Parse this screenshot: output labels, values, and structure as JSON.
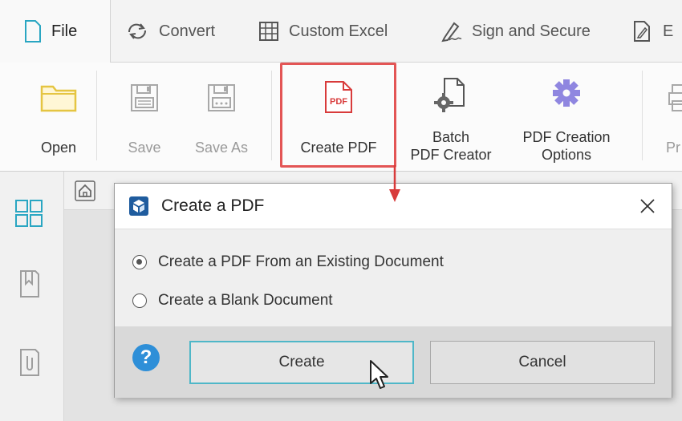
{
  "tabs": [
    {
      "label": "File",
      "icon": "file-icon",
      "active": true
    },
    {
      "label": "Convert",
      "icon": "convert-icon"
    },
    {
      "label": "Custom Excel",
      "icon": "table-icon"
    },
    {
      "label": "Sign and Secure",
      "icon": "signature-icon"
    },
    {
      "label": "E",
      "icon": "edit-icon"
    }
  ],
  "ribbon": {
    "open": "Open",
    "save": "Save",
    "save_as": "Save As",
    "create_pdf": "Create PDF",
    "create_pdf_icon_text": "PDF",
    "batch_line1": "Batch",
    "batch_line2": "PDF Creator",
    "options_line1": "PDF Creation",
    "options_line2": "Options",
    "partial": "Pr"
  },
  "dialog": {
    "title": "Create a PDF",
    "options": [
      {
        "label": "Create a PDF From an Existing Document",
        "checked": true
      },
      {
        "label": "Create a Blank Document",
        "checked": false
      }
    ],
    "help": "?",
    "create_label": "Create",
    "cancel_label": "Cancel"
  },
  "colors": {
    "highlight_red": "#e35555",
    "accent_teal": "#4fb7c8",
    "folder_yellow": "#e5c542",
    "pdf_red": "#d83b3b",
    "gear_purple": "#8f86e0",
    "help_blue": "#2e8fd8",
    "sidebar_teal": "#2aa6c2"
  }
}
